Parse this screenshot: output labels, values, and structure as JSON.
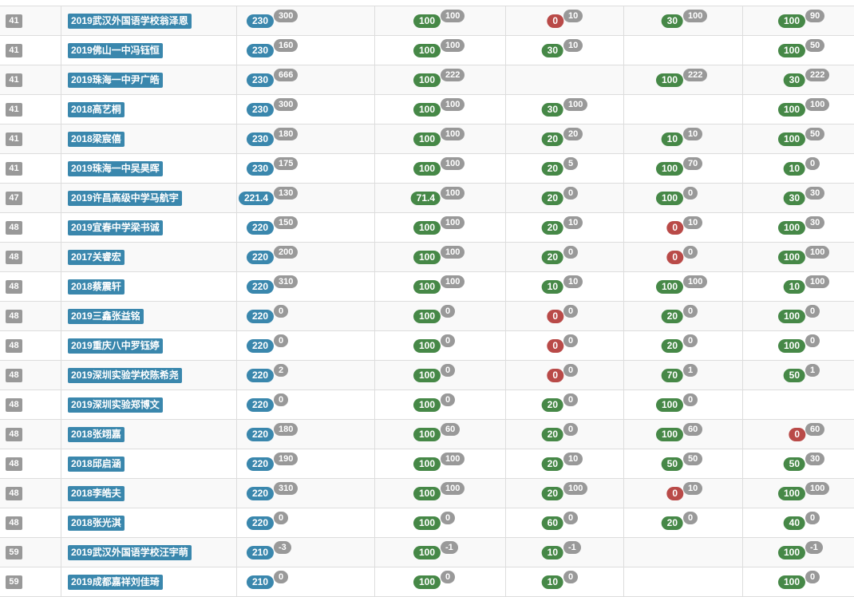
{
  "colors": {
    "total": "#3a87ad",
    "pass": "#468847",
    "fail": "#b94a48",
    "muted": "#999999",
    "name": "#3a87ad"
  },
  "rows": [
    {
      "rank": "41",
      "name": "2019武汉外国语学校翁泽恩",
      "total": "230",
      "total_sub": "300",
      "p": [
        [
          "100",
          "100",
          "green"
        ],
        [
          "0",
          "10",
          "red"
        ],
        [
          "30",
          "100",
          "green"
        ],
        [
          "100",
          "90",
          "green"
        ]
      ]
    },
    {
      "rank": "41",
      "name": "2019佛山一中冯钰恒",
      "total": "230",
      "total_sub": "160",
      "p": [
        [
          "100",
          "100",
          "green"
        ],
        [
          "30",
          "10",
          "green"
        ],
        null,
        [
          "100",
          "50",
          "green"
        ]
      ]
    },
    {
      "rank": "41",
      "name": "2019珠海一中尹广皓",
      "total": "230",
      "total_sub": "666",
      "p": [
        [
          "100",
          "222",
          "green"
        ],
        null,
        [
          "100",
          "222",
          "green"
        ],
        [
          "30",
          "222",
          "green"
        ]
      ]
    },
    {
      "rank": "41",
      "name": "2018高艺桐",
      "total": "230",
      "total_sub": "300",
      "p": [
        [
          "100",
          "100",
          "green"
        ],
        [
          "30",
          "100",
          "green"
        ],
        null,
        [
          "100",
          "100",
          "green"
        ]
      ]
    },
    {
      "rank": "41",
      "name": "2018梁宸僖",
      "total": "230",
      "total_sub": "180",
      "p": [
        [
          "100",
          "100",
          "green"
        ],
        [
          "20",
          "20",
          "green"
        ],
        [
          "10",
          "10",
          "green"
        ],
        [
          "100",
          "50",
          "green"
        ]
      ]
    },
    {
      "rank": "41",
      "name": "2019珠海一中吴昊晖",
      "total": "230",
      "total_sub": "175",
      "p": [
        [
          "100",
          "100",
          "green"
        ],
        [
          "20",
          "5",
          "green"
        ],
        [
          "100",
          "70",
          "green"
        ],
        [
          "10",
          "0",
          "green"
        ]
      ]
    },
    {
      "rank": "47",
      "name": "2019许昌高级中学马航宇",
      "total": "221.4",
      "total_sub": "130",
      "p": [
        [
          "71.4",
          "100",
          "green"
        ],
        [
          "20",
          "0",
          "green"
        ],
        [
          "100",
          "0",
          "green"
        ],
        [
          "30",
          "30",
          "green"
        ]
      ]
    },
    {
      "rank": "48",
      "name": "2019宜春中学梁书诚",
      "total": "220",
      "total_sub": "150",
      "p": [
        [
          "100",
          "100",
          "green"
        ],
        [
          "20",
          "10",
          "green"
        ],
        [
          "0",
          "10",
          "red"
        ],
        [
          "100",
          "30",
          "green"
        ]
      ]
    },
    {
      "rank": "48",
      "name": "2017关睿宏",
      "total": "220",
      "total_sub": "200",
      "p": [
        [
          "100",
          "100",
          "green"
        ],
        [
          "20",
          "0",
          "green"
        ],
        [
          "0",
          "0",
          "red"
        ],
        [
          "100",
          "100",
          "green"
        ]
      ]
    },
    {
      "rank": "48",
      "name": "2018蔡震轩",
      "total": "220",
      "total_sub": "310",
      "p": [
        [
          "100",
          "100",
          "green"
        ],
        [
          "10",
          "10",
          "green"
        ],
        [
          "100",
          "100",
          "green"
        ],
        [
          "10",
          "100",
          "green"
        ]
      ]
    },
    {
      "rank": "48",
      "name": "2019三鑫张益铭",
      "total": "220",
      "total_sub": "0",
      "p": [
        [
          "100",
          "0",
          "green"
        ],
        [
          "0",
          "0",
          "red"
        ],
        [
          "20",
          "0",
          "green"
        ],
        [
          "100",
          "0",
          "green"
        ]
      ]
    },
    {
      "rank": "48",
      "name": "2019重庆八中罗钰婷",
      "total": "220",
      "total_sub": "0",
      "p": [
        [
          "100",
          "0",
          "green"
        ],
        [
          "0",
          "0",
          "red"
        ],
        [
          "20",
          "0",
          "green"
        ],
        [
          "100",
          "0",
          "green"
        ]
      ]
    },
    {
      "rank": "48",
      "name": "2019深圳实验学校陈希尧",
      "total": "220",
      "total_sub": "2",
      "p": [
        [
          "100",
          "0",
          "green"
        ],
        [
          "0",
          "0",
          "red"
        ],
        [
          "70",
          "1",
          "green"
        ],
        [
          "50",
          "1",
          "green"
        ]
      ]
    },
    {
      "rank": "48",
      "name": "2019深圳实验郑博文",
      "total": "220",
      "total_sub": "0",
      "p": [
        [
          "100",
          "0",
          "green"
        ],
        [
          "20",
          "0",
          "green"
        ],
        [
          "100",
          "0",
          "green"
        ],
        null
      ]
    },
    {
      "rank": "48",
      "name": "2018张翊嘉",
      "total": "220",
      "total_sub": "180",
      "p": [
        [
          "100",
          "60",
          "green"
        ],
        [
          "20",
          "0",
          "green"
        ],
        [
          "100",
          "60",
          "green"
        ],
        [
          "0",
          "60",
          "red"
        ]
      ]
    },
    {
      "rank": "48",
      "name": "2018邱启涵",
      "total": "220",
      "total_sub": "190",
      "p": [
        [
          "100",
          "100",
          "green"
        ],
        [
          "20",
          "10",
          "green"
        ],
        [
          "50",
          "50",
          "green"
        ],
        [
          "50",
          "30",
          "green"
        ]
      ]
    },
    {
      "rank": "48",
      "name": "2018李皓夫",
      "total": "220",
      "total_sub": "310",
      "p": [
        [
          "100",
          "100",
          "green"
        ],
        [
          "20",
          "100",
          "green"
        ],
        [
          "0",
          "10",
          "red"
        ],
        [
          "100",
          "100",
          "green"
        ]
      ]
    },
    {
      "rank": "48",
      "name": "2018张光淇",
      "total": "220",
      "total_sub": "0",
      "p": [
        [
          "100",
          "0",
          "green"
        ],
        [
          "60",
          "0",
          "green"
        ],
        [
          "20",
          "0",
          "green"
        ],
        [
          "40",
          "0",
          "green"
        ]
      ]
    },
    {
      "rank": "59",
      "name": "2019武汉外国语学校汪宇萌",
      "total": "210",
      "total_sub": "-3",
      "p": [
        [
          "100",
          "-1",
          "green"
        ],
        [
          "10",
          "-1",
          "green"
        ],
        null,
        [
          "100",
          "-1",
          "green"
        ]
      ]
    },
    {
      "rank": "59",
      "name": "2019成都嘉祥刘佳琦",
      "total": "210",
      "total_sub": "0",
      "p": [
        [
          "100",
          "0",
          "green"
        ],
        [
          "10",
          "0",
          "green"
        ],
        null,
        [
          "100",
          "0",
          "green"
        ]
      ]
    }
  ]
}
